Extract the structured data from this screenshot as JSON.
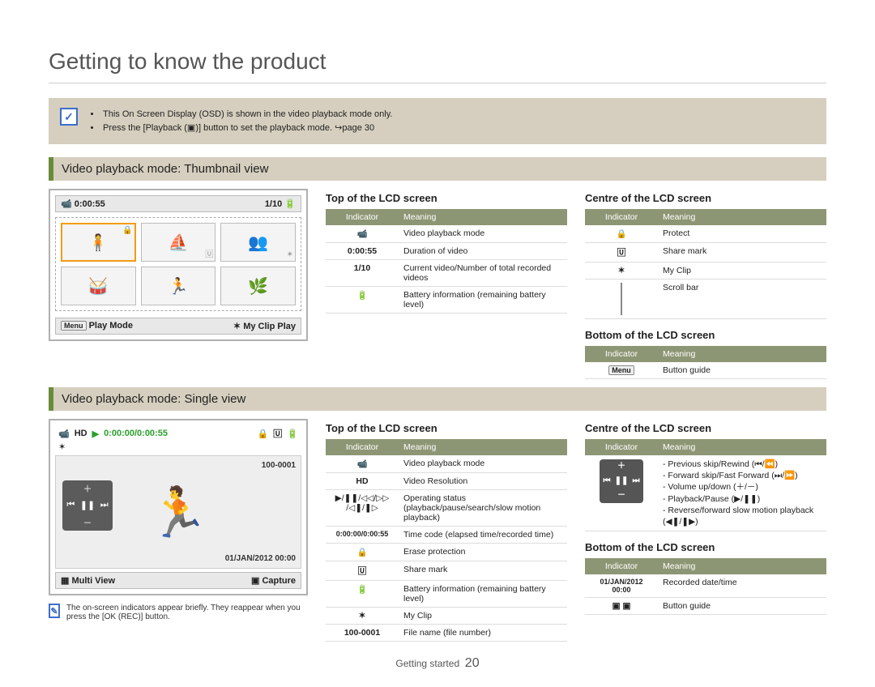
{
  "page_title": "Getting to know the product",
  "notes": {
    "items": [
      "This On Screen Display (OSD) is shown in the video playback mode only.",
      "Press the [Playback (▣)] button to set the playback mode. ↪page 30"
    ]
  },
  "section1_header": "Video playback mode: Thumbnail view",
  "section2_header": "Video playback mode: Single view",
  "thumb_screen": {
    "duration": "0:00:55",
    "counter": "1/10",
    "bottom_left_icon": "Menu",
    "bottom_left": "Play Mode",
    "bottom_right": "My Clip Play"
  },
  "single_screen": {
    "timecode": "0:00:00/0:00:55",
    "file_no": "100-0001",
    "date": "01/JAN/2012 00:00",
    "bottom_left": "Multi View",
    "bottom_right": "Capture"
  },
  "s1_top": {
    "title": "Top of the LCD screen",
    "th_ind": "Indicator",
    "th_mean": "Meaning",
    "rows": [
      {
        "ind": "📹",
        "mean": "Video playback mode"
      },
      {
        "ind": "0:00:55",
        "mean": "Duration of video"
      },
      {
        "ind": "1/10",
        "mean": "Current video/Number of total recorded videos"
      },
      {
        "ind": "🔋",
        "mean": "Battery information (remaining battery level)"
      }
    ]
  },
  "s1_centre": {
    "title": "Centre of the LCD screen",
    "th_ind": "Indicator",
    "th_mean": "Meaning",
    "rows": [
      {
        "ind": "🔒",
        "mean": "Protect"
      },
      {
        "ind": "🅄",
        "mean": "Share mark"
      },
      {
        "ind": "✶",
        "mean": "My Clip"
      },
      {
        "ind": "▮",
        "mean": "Scroll bar"
      }
    ]
  },
  "s1_bottom": {
    "title": "Bottom of the LCD screen",
    "th_ind": "Indicator",
    "th_mean": "Meaning",
    "rows": [
      {
        "ind": "Menu",
        "mean": "Button guide"
      }
    ]
  },
  "s2_top": {
    "title": "Top of the LCD screen",
    "th_ind": "Indicator",
    "th_mean": "Meaning",
    "rows": [
      {
        "ind": "📹",
        "mean": "Video playback mode"
      },
      {
        "ind": "HD",
        "mean": "Video Resolution"
      },
      {
        "ind": "▶/❚❚/◁◁/▷▷\n/◁❚/❚▷",
        "mean": "Operating status (playback/pause/search/slow motion playback)"
      },
      {
        "ind": "0:00:00/0:00:55",
        "mean": "Time code (elapsed time/recorded time)"
      },
      {
        "ind": "🔒",
        "mean": "Erase protection"
      },
      {
        "ind": "🅄",
        "mean": "Share mark"
      },
      {
        "ind": "🔋",
        "mean": "Battery information (remaining battery level)"
      },
      {
        "ind": "✶",
        "mean": "My Clip"
      },
      {
        "ind": "100-0001",
        "mean": "File name (file number)"
      }
    ]
  },
  "s2_centre": {
    "title": "Centre of the LCD screen",
    "th_ind": "Indicator",
    "th_mean": "Meaning",
    "rows": [
      {
        "ind": "PAD",
        "mean": "- Previous skip/Rewind (⏮/⏪)\n- Forward skip/Fast Forward (⏭/⏩)\n- Volume up/down (＋/－)\n- Playback/Pause (▶/❚❚)\n- Reverse/forward slow motion playback (◀❚/❚▶)"
      }
    ]
  },
  "s2_bottom": {
    "title": "Bottom of the LCD screen",
    "th_ind": "Indicator",
    "th_mean": "Meaning",
    "rows": [
      {
        "ind": "01/JAN/2012 00:00",
        "mean": "Recorded date/time"
      },
      {
        "ind": "▣ ▣",
        "mean": "Button guide"
      }
    ]
  },
  "tiny_note": "The on-screen indicators appear briefly. They reappear when you press the [OK (REC)] button.",
  "footer_label": "Getting started",
  "footer_page": "20"
}
